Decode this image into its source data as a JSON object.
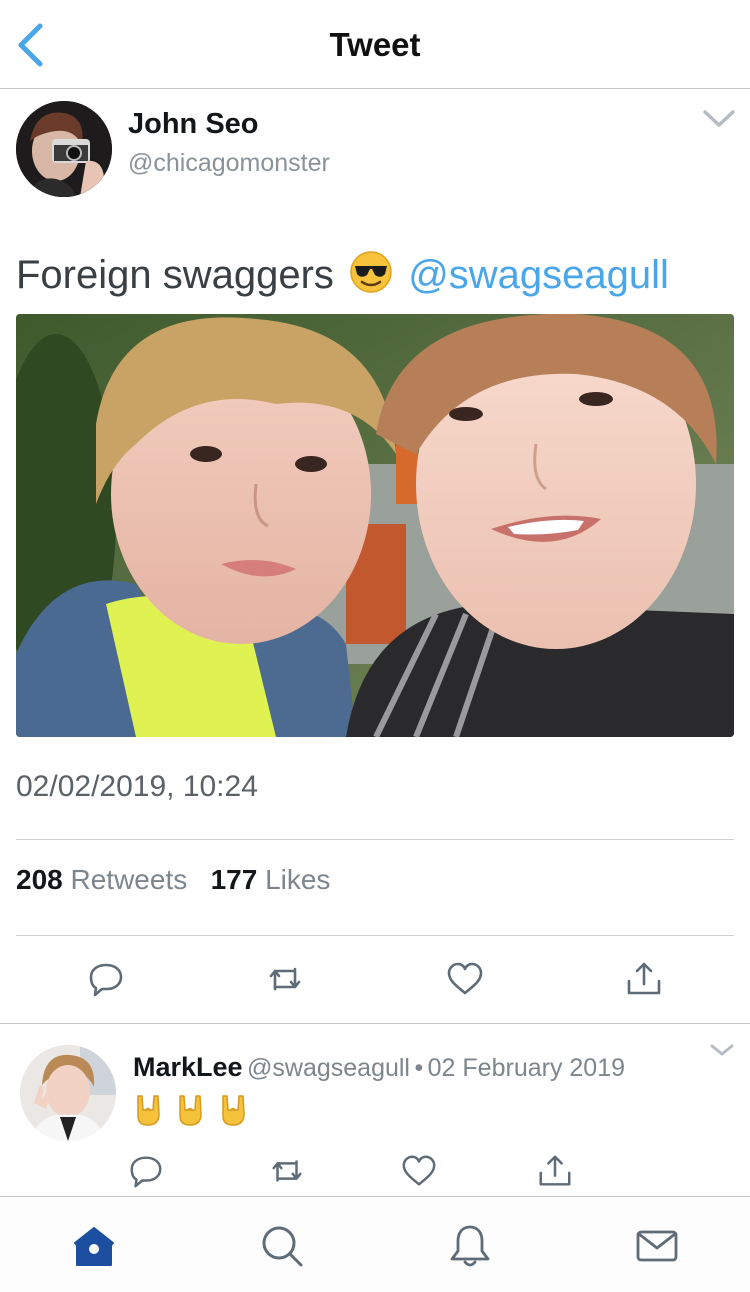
{
  "header": {
    "title": "Tweet",
    "back_icon": "chevron-left-icon"
  },
  "tweet": {
    "author_name": "John Seo",
    "author_handle": "@chicagomonster",
    "text": "Foreign swaggers",
    "emoji": "smiling-face-with-sunglasses",
    "mention": "@swagseagull",
    "timestamp": "02/02/2019, 10:24",
    "retweet_count": "208",
    "retweet_label": "Retweets",
    "like_count": "177",
    "like_label": "Likes",
    "actions": [
      "reply-icon",
      "retweet-icon",
      "like-icon",
      "share-icon"
    ]
  },
  "reply": {
    "author_name": "MarkLee",
    "author_handle": "@swagseagull",
    "separator": "•",
    "date": "02 February 2019",
    "emojis": [
      "sign-of-the-horns",
      "sign-of-the-horns",
      "sign-of-the-horns"
    ],
    "actions": [
      "reply-icon",
      "retweet-icon",
      "like-icon",
      "share-icon"
    ]
  },
  "tabbar": {
    "tabs": [
      "home-icon",
      "search-icon",
      "notifications-icon",
      "messages-icon"
    ],
    "active": "home-icon"
  },
  "colors": {
    "accent": "#49a6e9",
    "icon_gray": "#5f6b77",
    "active_tab": "#1d4fa0",
    "secondary_text": "#7d858d",
    "divider": "#c8c8cc"
  }
}
